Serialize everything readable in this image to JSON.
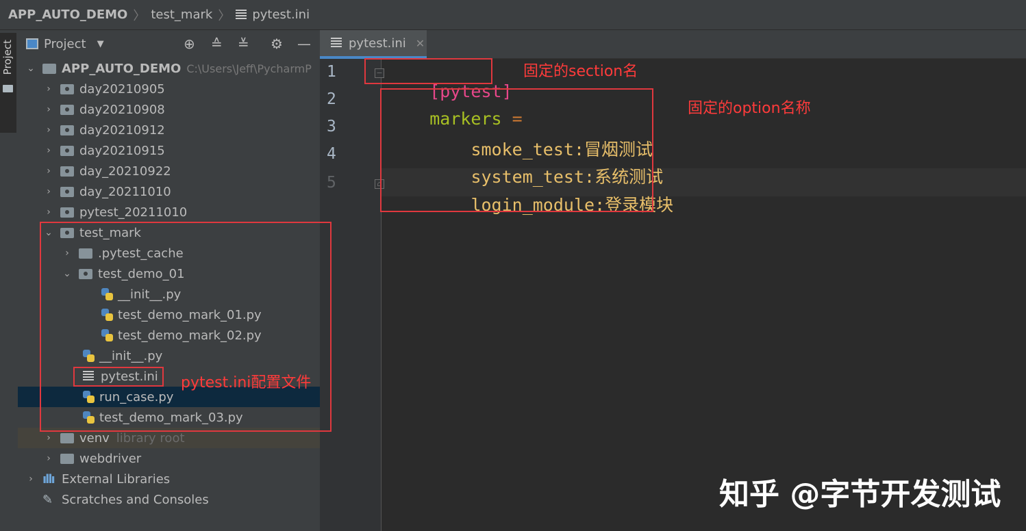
{
  "breadcrumb": {
    "project": "APP_AUTO_DEMO",
    "folder": "test_mark",
    "file": "pytest.ini"
  },
  "tool_strip": {
    "label": "Project"
  },
  "panel": {
    "title": "Project",
    "tree": [
      {
        "label": "APP_AUTO_DEMO",
        "path": "C:\\Users\\Jeff\\PycharmP",
        "kind": "root-folder"
      },
      {
        "label": "day20210905",
        "kind": "folder"
      },
      {
        "label": "day20210908",
        "kind": "folder"
      },
      {
        "label": "day20210912",
        "kind": "folder"
      },
      {
        "label": "day20210915",
        "kind": "folder"
      },
      {
        "label": "day_20210922",
        "kind": "folder"
      },
      {
        "label": "day_20211010",
        "kind": "folder"
      },
      {
        "label": "pytest_20211010",
        "kind": "folder"
      },
      {
        "label": "test_mark",
        "kind": "folder"
      },
      {
        "label": ".pytest_cache",
        "kind": "folder"
      },
      {
        "label": "test_demo_01",
        "kind": "folder"
      },
      {
        "label": "__init__.py",
        "kind": "python"
      },
      {
        "label": "test_demo_mark_01.py",
        "kind": "python"
      },
      {
        "label": "test_demo_mark_02.py",
        "kind": "python"
      },
      {
        "label": "__init__.py",
        "kind": "python"
      },
      {
        "label": "pytest.ini",
        "kind": "ini"
      },
      {
        "label": "run_case.py",
        "kind": "python"
      },
      {
        "label": "test_demo_mark_03.py",
        "kind": "python"
      },
      {
        "label": "venv",
        "hint": "library root",
        "kind": "folder"
      },
      {
        "label": "webdriver",
        "kind": "folder"
      },
      {
        "label": "External Libraries",
        "kind": "libraries"
      },
      {
        "label": "Scratches and Consoles",
        "kind": "scratches"
      }
    ]
  },
  "editor": {
    "tab": "pytest.ini",
    "line_numbers": [
      "1",
      "2",
      "3",
      "4",
      "5"
    ],
    "lines": {
      "l1": "[pytest]",
      "l2_key": "markers",
      "l2_eq": " =",
      "l3_key": "smoke_test",
      "l3_val": ":冒烟测试",
      "l4_key": "system_test",
      "l4_val": ":系统测试",
      "l5_key": "login_module",
      "l5_val": ":登录模块"
    }
  },
  "annotations": {
    "section": "固定的section名",
    "option": "固定的option名称",
    "config": "pytest.ini配置文件"
  },
  "watermark": "知乎 @字节开发测试",
  "colors": {
    "annotation_red": "#e0383e",
    "section_pink": "#e8478b",
    "markers_green": "#a8c023",
    "value_yellow": "#e8bf6a",
    "selection_blue": "#0d293e"
  }
}
